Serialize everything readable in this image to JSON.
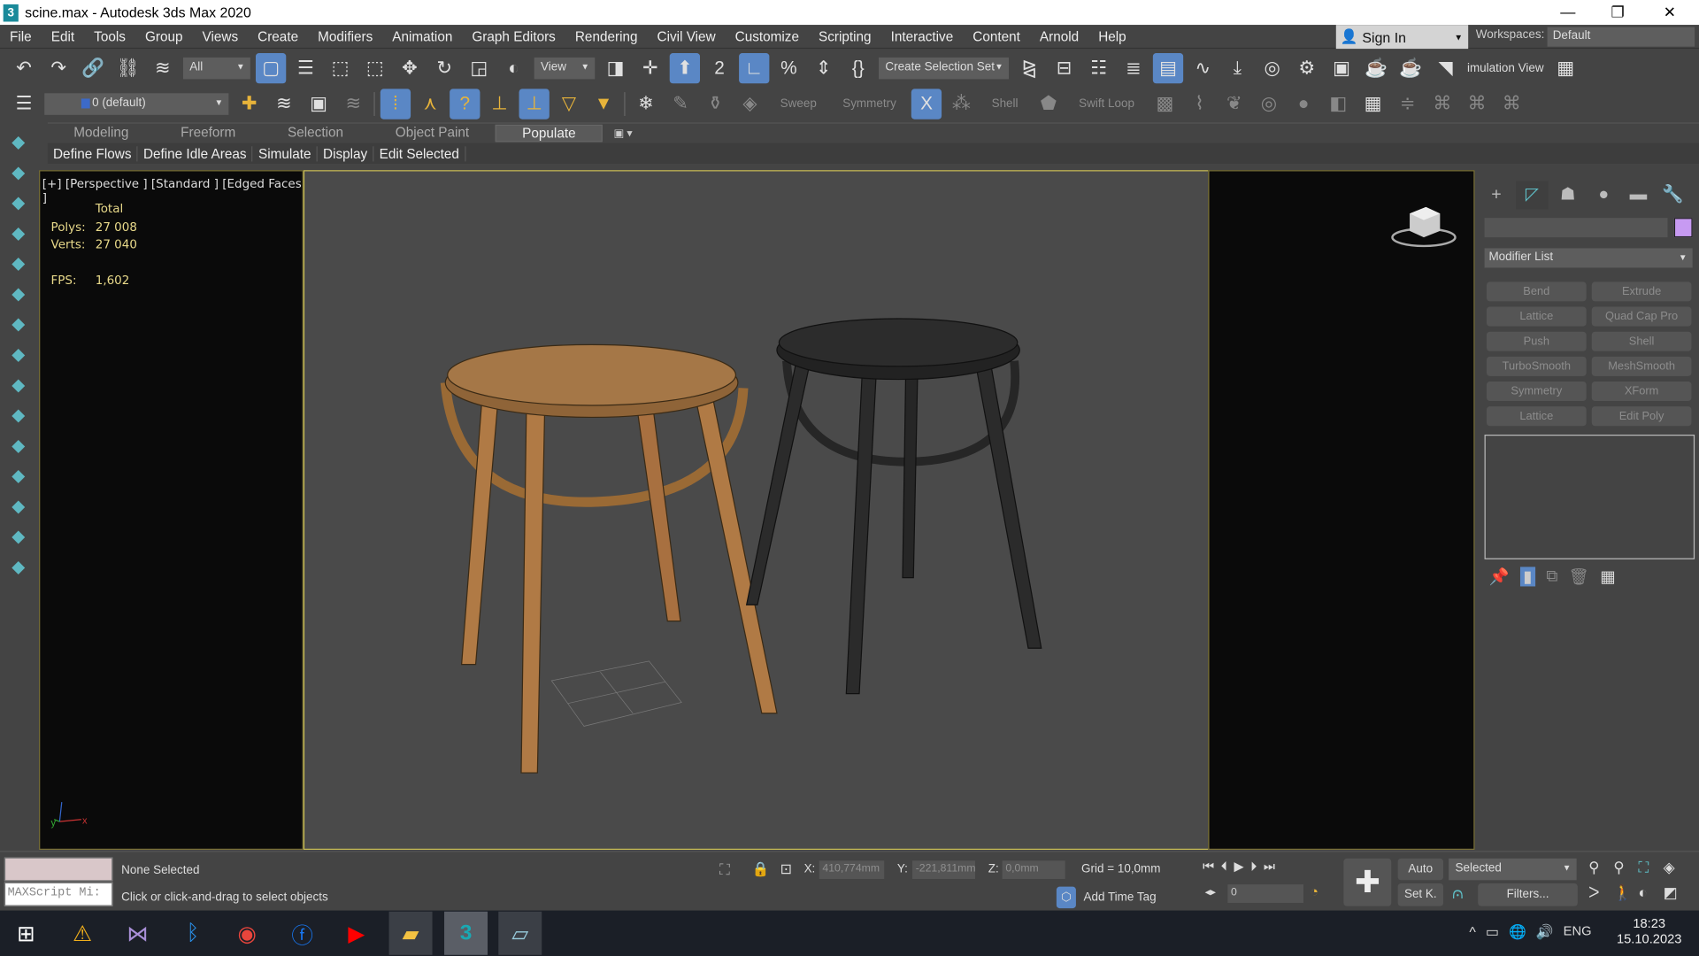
{
  "window": {
    "title": "scine.max - Autodesk 3ds Max 2020",
    "app_icon": "3",
    "minimize": "—",
    "restore": "❐",
    "close": "✕"
  },
  "menu": [
    "File",
    "Edit",
    "Tools",
    "Group",
    "Views",
    "Create",
    "Modifiers",
    "Animation",
    "Graph Editors",
    "Rendering",
    "Civil View",
    "Customize",
    "Scripting",
    "Interactive",
    "Content",
    "Arnold",
    "Help"
  ],
  "account": {
    "sign_in": "Sign In",
    "workspaces_label": "Workspaces:",
    "workspace": "Default"
  },
  "toolbar1": {
    "filter": "All",
    "ref_coord": "View",
    "selection_set": "Create Selection Set",
    "sim_view": "imulation View",
    "icons_a": [
      "undo-icon",
      "redo-icon",
      "link-icon",
      "unlink-icon",
      "bind-spacewarp-icon"
    ],
    "icons_b": [
      "select-object-icon",
      "select-by-name-icon",
      "rect-selection-icon",
      "window-crossing-icon",
      "move-icon",
      "rotate-icon",
      "scale-icon",
      "placement-icon"
    ],
    "icons_c": [
      "pivot-icon",
      "transform-center-icon",
      "manipulate-icon",
      "snap-2-5-icon",
      "angle-snap-icon",
      "percent-snap-icon",
      "spinner-snap-icon",
      "edit-named-sets-icon"
    ],
    "icons_d": [
      "mirror-icon",
      "align-icon",
      "scene-explorer-icon",
      "layer-explorer-icon",
      "toggle-ribbon-icon",
      "curve-editor-icon",
      "dope-sheet-icon",
      "material-editor-icon",
      "render-setup-icon",
      "rendered-frame-window-icon",
      "render-production-icon",
      "render-iterative-icon",
      "simulation-view-icon"
    ],
    "icons_e": [
      "viewport-layout-icon"
    ]
  },
  "toolbar2": {
    "layer": "0 (default)",
    "sweep": "Sweep",
    "symmetry": "Symmetry",
    "shell": "Shell",
    "swift_loop": "Swift Loop"
  },
  "ribbon": {
    "tabs": [
      "Modeling",
      "Freeform",
      "Selection",
      "Object Paint",
      "Populate"
    ],
    "active": "Populate",
    "subtabs": [
      "Define Flows",
      "Define Idle Areas",
      "Simulate",
      "Display",
      "Edit Selected"
    ]
  },
  "viewport": {
    "label": "[+] [Perspective ] [Standard ] [Edged Faces ]",
    "total": "Total",
    "polys_label": "Polys:",
    "polys": "27 008",
    "verts_label": "Verts:",
    "verts": "27 040",
    "fps_label": "FPS:",
    "fps": "1,602",
    "axis_x": "x",
    "axis_y": "y"
  },
  "command_panel": {
    "modifier_list": "Modifier List",
    "swatch_color": "#c79af2",
    "modifiers": [
      "Bend",
      "Extrude",
      "Lattice",
      "Quad Cap Pro",
      "Push",
      "Shell",
      "TurboSmooth",
      "MeshSmooth",
      "Symmetry",
      "XForm",
      "Lattice",
      "Edit Poly"
    ]
  },
  "status": {
    "maxscript": "MAXScript Mi:",
    "selection": "None Selected",
    "prompt": "Click or click-and-drag to select objects",
    "x_label": "X:",
    "x": "410,774mm",
    "y_label": "Y:",
    "y": "-221,811mm",
    "z_label": "Z:",
    "z": "0,0mm",
    "grid": "Grid = 10,0mm",
    "add_time_tag": "Add Time Tag",
    "frame": "0",
    "auto": "Auto",
    "set_key": "Set K.",
    "key_filter": "Selected",
    "filters": "Filters..."
  },
  "taskbar": {
    "lang": "ENG",
    "time": "18:23",
    "date": "15.10.2023"
  }
}
